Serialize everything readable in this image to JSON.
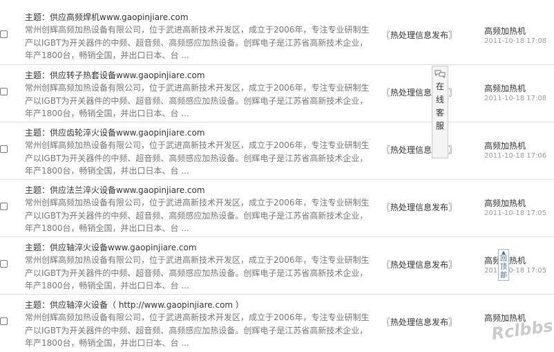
{
  "rows": [
    {
      "title": "主题：供应高频焊机www.gaopinjiare.com",
      "desc": "常州创辉高频加热设备有限公司，位于武进高新技术开发区，成立于2006年，专注专业研制生产以IGBT为开关器件的中频、超音频、高频感应加热设备。创辉电子是江苏省高新技术企业，年产1800台，畅销全国，并出口日本、台 ...",
      "category": "〖热处理信息发布〗",
      "author": "高频加热机",
      "date": "2011-10-18 17:08"
    },
    {
      "title": "主题：供应转子热套设备www.gaopinjiare.com",
      "desc": "常州创辉高频加热设备有限公司，位于武进高新技术开发区，成立于2006年，专注专业研制生产以IGBT为开关器件的中频、超音频、高频感应加热设备。创辉电子是江苏省高新技术企业，年产1800台，畅销全国，并出口日本、台 ...",
      "category": "〖热处理信息发布〗",
      "author": "高频加热机",
      "date": "2011-10-18 17:08"
    },
    {
      "title": "主题：供应齿轮淬火设备www.gaopinjiare.com",
      "desc": "常州创辉高频加热设备有限公司，位于武进高新技术开发区，成立于2006年，专注专业研制生产以IGBT为开关器件的中频、超音频、高频感应加热设备。创辉电子是江苏省高新技术企业，年产1800台，畅销全国，并出口日本、台 ...",
      "category": "〖热处理信息发布〗",
      "author": "高频加热机",
      "date": "2011-10-18 17:06"
    },
    {
      "title": "主题：供应法兰淬火设备www.gaopinjiare.com",
      "desc": "常州创辉高频加热设备有限公司，位于武进高新技术开发区，成立于2006年，专注专业研制生产以IGBT为开关器件的中频、超音频、高频感应加热设备。创辉电子是江苏省高新技术企业，年产1800台，畅销全国，并出口日本、台 ...",
      "category": "〖热处理信息发布〗",
      "author": "高频加热机",
      "date": "2011-10-18 17:05"
    },
    {
      "title": "主题：供应轴淬火设备www.gaopinjiare.com",
      "desc": "常州创辉高频加热设备有限公司，位于武进高新技术开发区，成立于2006年，专注专业研制生产以IGBT为开关器件的中频、超音频、高频感应加热设备。创辉电子是江苏省高新技术企业，年产1800台，畅销全国，并出口日本、台 ...",
      "category": "〖热处理信息发布〗",
      "author": "高频加热机",
      "date": "2011-10-18 17:05"
    },
    {
      "title": "主题：供应轴淬火设备（ http://www.gaopinjiare.com ）",
      "desc": "常州创辉高频加热设备有限公司，位于武进高新技术开发区，成立于2006年，专注专业研制生产以IGBT为开关器件的中频、超音频、高频感应加热设备。创辉电子是江苏省高新技术企业，年产1800台，畅销全国，并出口日本、台 ...",
      "category": "〖热处理信息发布〗",
      "author": "高频加热机",
      "date": ""
    }
  ],
  "kefu": {
    "chars": [
      "在",
      "线",
      "客",
      "服"
    ]
  },
  "totop": {
    "chars": [
      "回",
      "顶",
      "部"
    ]
  },
  "watermark": "Rclbbs",
  "colors": {
    "title": "#333333",
    "desc": "#777777",
    "date": "#9a9a9a",
    "border": "#dcdcdc"
  }
}
